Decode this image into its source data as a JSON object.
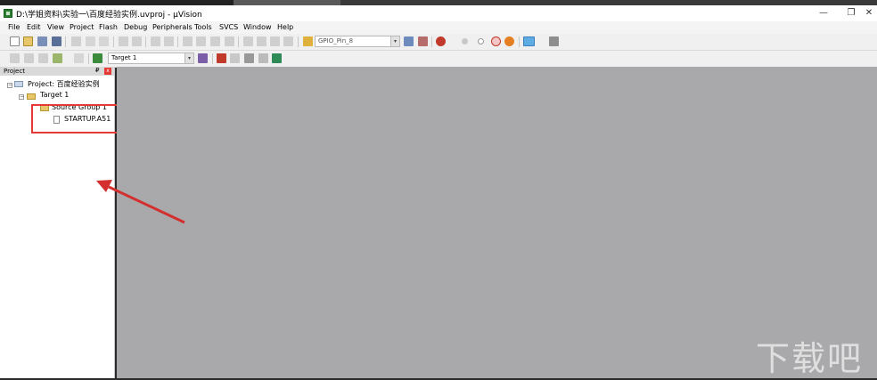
{
  "window": {
    "title": "D:\\学姐资料\\实验一\\百度经验实例.uvproj - µVision",
    "controls": {
      "minimize": "—",
      "maximize": "❐",
      "close": "✕"
    }
  },
  "menu": [
    "File",
    "Edit",
    "View",
    "Project",
    "Flash",
    "Debug",
    "Peripherals",
    "Tools",
    "SVCS",
    "Window",
    "Help"
  ],
  "toolbar": {
    "find_combo": "GPIO_Pin_8",
    "target_combo": "Target 1"
  },
  "project_pane": {
    "title": "Project",
    "pin_glyph": "₽",
    "close_glyph": "x",
    "tree": {
      "project": "Project: 百度经验实例",
      "target": "Target 1",
      "group": "Source Group 1",
      "file": "STARTUP.A51"
    }
  },
  "watermark": "下载吧",
  "colors": {
    "highlight": "#e53935",
    "editor_bg": "#a9a8aa"
  }
}
